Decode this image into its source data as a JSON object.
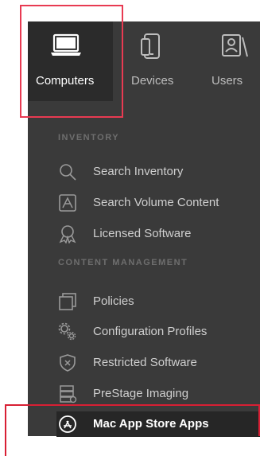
{
  "tabs": [
    {
      "label": "Computers",
      "icon": "laptop-icon",
      "active": true
    },
    {
      "label": "Devices",
      "icon": "mobile-device-icon",
      "active": false
    },
    {
      "label": "Users",
      "icon": "user-card-icon",
      "active": false
    }
  ],
  "sections": {
    "inventory": "INVENTORY",
    "content_management": "CONTENT MANAGEMENT"
  },
  "inventory_items": [
    {
      "label": "Search Inventory",
      "icon": "search-icon"
    },
    {
      "label": "Search Volume Content",
      "icon": "volume-content-icon"
    },
    {
      "label": "Licensed Software",
      "icon": "license-award-icon"
    }
  ],
  "content_items": [
    {
      "label": "Policies",
      "icon": "policies-icon"
    },
    {
      "label": "Configuration Profiles",
      "icon": "gears-icon"
    },
    {
      "label": "Restricted Software",
      "icon": "restricted-shield-icon"
    },
    {
      "label": "PreStage Imaging",
      "icon": "disk-stack-icon"
    },
    {
      "label": "Mac App Store Apps",
      "icon": "app-store-icon",
      "active": true
    }
  ],
  "colors": {
    "panel_bg": "#3a3a3a",
    "active_bg": "#262626",
    "highlight": "#e83a52"
  }
}
